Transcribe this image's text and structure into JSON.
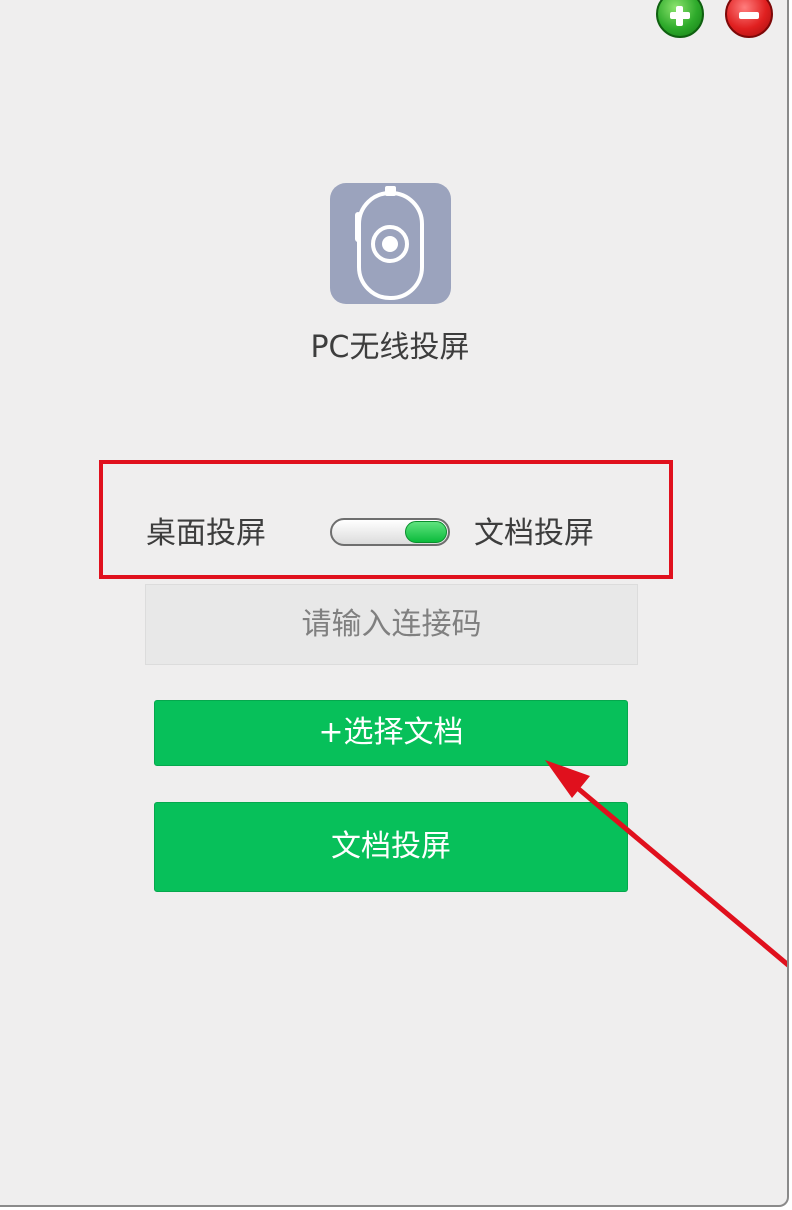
{
  "app": {
    "title": "PC无线投屏"
  },
  "window_controls": {
    "add_icon": "add-icon",
    "remove_icon": "remove-icon"
  },
  "mode_switch": {
    "left_label": "桌面投屏",
    "right_label": "文档投屏",
    "selected": "文档投屏",
    "highlight_color": "#e0101d"
  },
  "connection_code": {
    "value": "",
    "placeholder": "请输入连接码"
  },
  "buttons": {
    "select_document": "+选择文档",
    "document_cast": "文档投屏"
  },
  "colors": {
    "accent": "#07c05a",
    "annotation": "#e0101d",
    "icon_bg": "#9ba3bd"
  }
}
